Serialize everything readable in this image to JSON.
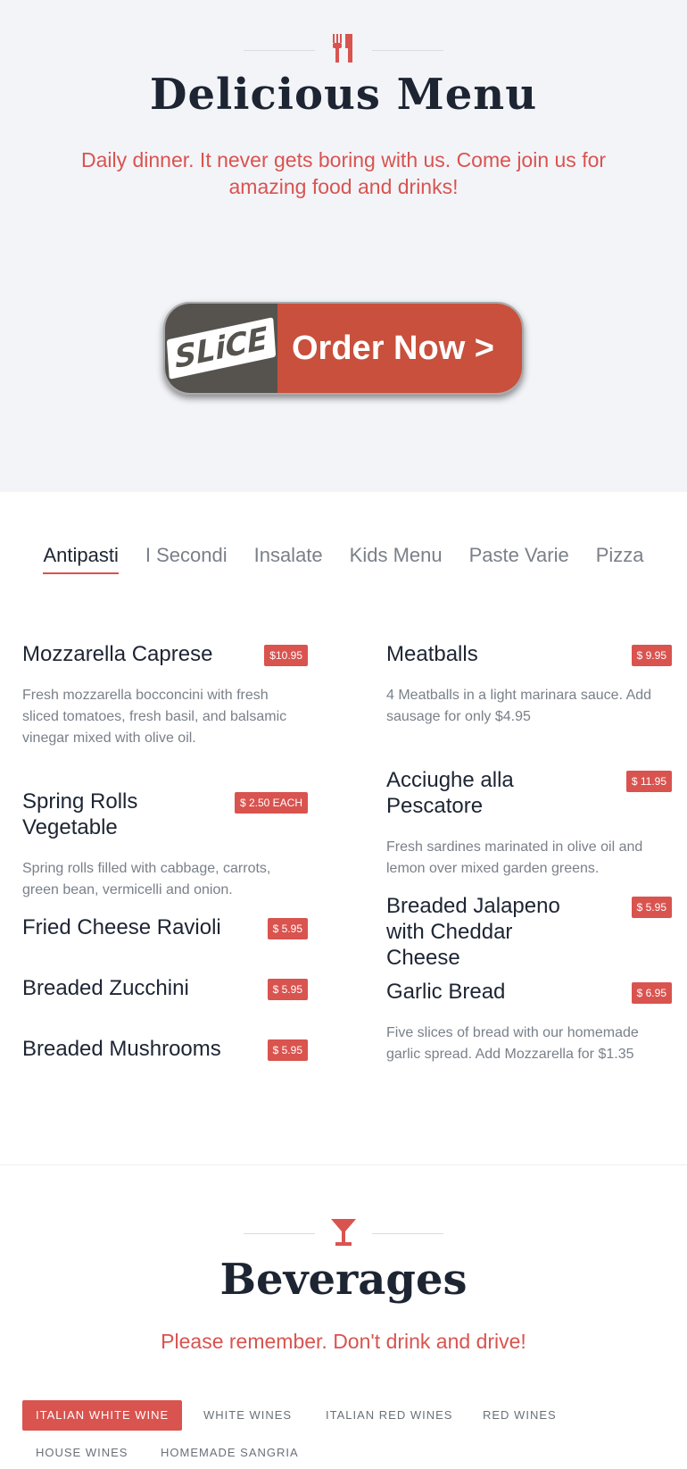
{
  "hero": {
    "title": "Delicious Menu",
    "subtitle": "Daily dinner. It never gets boring with us. Come join us for amazing food and drinks!",
    "icon": "fork-knife-icon",
    "order_button": {
      "logo_text": "SLiCE",
      "label": "Order Now >"
    }
  },
  "menu_tabs": [
    "Antipasti",
    "I Secondi",
    "Insalate",
    "Kids Menu",
    "Paste Varie",
    "Pizza"
  ],
  "active_tab": "Antipasti",
  "menu": {
    "left": [
      {
        "name": "Mozzarella Caprese",
        "price": "$10.95",
        "desc": "Fresh mozzarella bocconcini with fresh sliced tomatoes, fresh basil, and balsamic vinegar mixed with olive oil."
      },
      {
        "name": "Spring Rolls Vegetable",
        "price": "$ 2.50 EACH",
        "desc": "Spring rolls filled with cabbage, carrots, green bean, vermicelli and onion."
      },
      {
        "name": "Fried Cheese Ravioli",
        "price": "$ 5.95",
        "desc": ""
      },
      {
        "name": "Breaded Zucchini",
        "price": "$ 5.95",
        "desc": ""
      },
      {
        "name": "Breaded Mushrooms",
        "price": "$ 5.95",
        "desc": ""
      }
    ],
    "right": [
      {
        "name": "Meatballs",
        "price": "$ 9.95",
        "desc": "4 Meatballs in a light marinara sauce. Add sausage for only $4.95"
      },
      {
        "name": "Acciughe alla Pescatore",
        "price": "$ 11.95",
        "desc": "Fresh sardines marinated in olive oil and lemon over mixed garden greens."
      },
      {
        "name": "Breaded Jalapeno with Cheddar Cheese",
        "price": "$ 5.95",
        "desc": ""
      },
      {
        "name": "Garlic Bread",
        "price": "$ 6.95",
        "desc": "Five slices of bread with our homemade garlic spread. Add Mozzarella for $1.35"
      }
    ]
  },
  "beverages": {
    "icon": "cocktail-glass-icon",
    "title": "Beverages",
    "subtitle": "Please remember. Don't drink and drive!",
    "tabs": [
      "ITALIAN WHITE WINE",
      "WHITE WINES",
      "ITALIAN RED WINES",
      "RED WINES",
      "HOUSE WINES",
      "HOMEMADE SANGRIA"
    ],
    "active_tab": "ITALIAN WHITE WINE"
  },
  "colors": {
    "accent": "#d9534f",
    "hero_bg": "#f3f4f8",
    "slice_gray": "#56534f",
    "slice_red": "#c8503c"
  }
}
